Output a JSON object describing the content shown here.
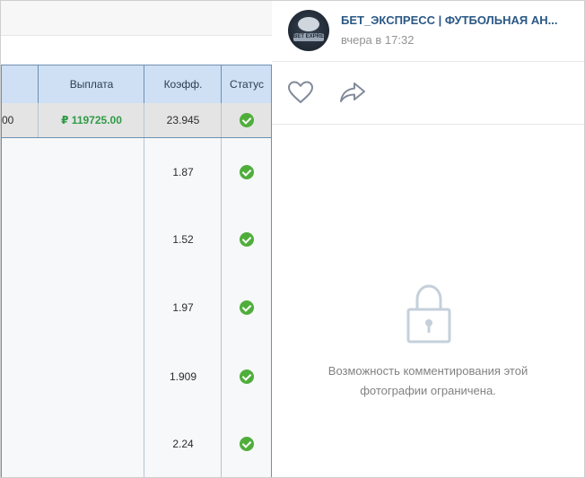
{
  "bet_table": {
    "headers": [
      "Выплата",
      "Коэфф.",
      "Статус"
    ],
    "total_row": {
      "partial_amount": "00",
      "payout": "₽ 119725.00",
      "coef": "23.945"
    },
    "rows": [
      {
        "coef": "1.87"
      },
      {
        "coef": "1.52"
      },
      {
        "coef": "1.97"
      },
      {
        "coef": "1.909"
      },
      {
        "coef": "2.24"
      }
    ],
    "status_icon": "check-circle-icon",
    "status_color": "#4fae3b",
    "header_bg": "#cfe0f5",
    "payout_color": "#2e9b45"
  },
  "post": {
    "author": "БЕТ_ЭКСПРЕСС | ФУТБОЛЬНАЯ АН...",
    "avatar_text": "BET EXPRESS",
    "time": "вчера в 17:32",
    "like_icon": "heart-icon",
    "share_icon": "share-arrow-icon",
    "link_color": "#2a5885"
  },
  "comments": {
    "lock_icon": "lock-icon",
    "restricted_line1": "Возможность комментирования этой",
    "restricted_line2": "фотографии ограничена."
  }
}
